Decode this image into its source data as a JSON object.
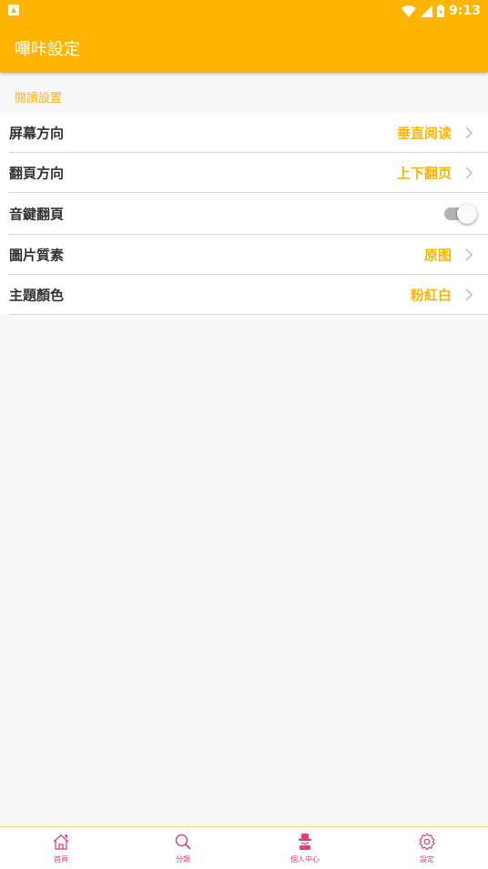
{
  "status_bar": {
    "time": "9:13"
  },
  "app_bar": {
    "title": "嗶咔設定"
  },
  "section": {
    "title": "閱讀設置"
  },
  "settings": [
    {
      "label": "屏幕方向",
      "value": "垂直阅读"
    },
    {
      "label": "翻頁方向",
      "value": "上下翻页"
    },
    {
      "label": "音鍵翻頁",
      "toggle": false
    },
    {
      "label": "圖片質素",
      "value": "原图"
    },
    {
      "label": "主題顏色",
      "value": "粉紅白"
    }
  ],
  "tabs": [
    {
      "label": "首頁",
      "icon": "home-icon"
    },
    {
      "label": "分類",
      "icon": "search-icon"
    },
    {
      "label": "個人中心",
      "icon": "profile-icon"
    },
    {
      "label": "設定",
      "icon": "gear-icon"
    }
  ],
  "colors": {
    "accent": "#ffb400",
    "tab": "#e8397c"
  }
}
